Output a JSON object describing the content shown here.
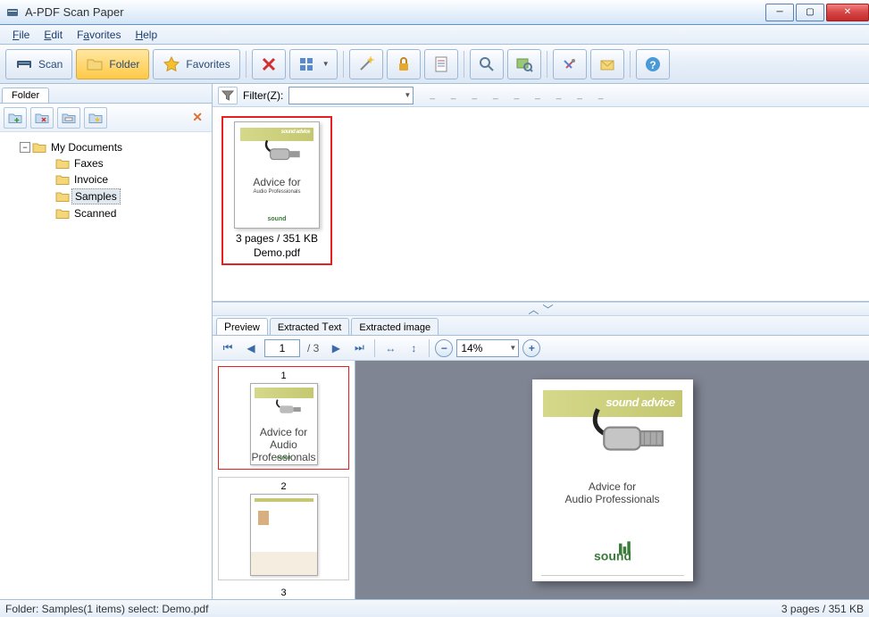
{
  "window": {
    "title": "A-PDF Scan Paper"
  },
  "menu": {
    "file": "File",
    "edit": "Edit",
    "favorites": "Favorites",
    "help": "Help"
  },
  "toolbar": {
    "scan": "Scan",
    "folder": "Folder",
    "favorites": "Favorites"
  },
  "folder_panel": {
    "tab": "Folder",
    "root": "My Documents",
    "children": [
      "Faxes",
      "Invoice",
      "Samples",
      "Scanned"
    ],
    "selected": "Samples"
  },
  "filter": {
    "label": "Filter(Z):"
  },
  "documents": [
    {
      "info": "3 pages / 351 KB",
      "filename": "Demo.pdf"
    }
  ],
  "doc_content": {
    "banner": "sound advice",
    "line1": "Advice for",
    "line2": "Audio Professionals",
    "logo": "sound"
  },
  "preview": {
    "tabs": [
      "Preview",
      "Extracted Text",
      "Extracted image"
    ],
    "active_tab": 0,
    "current_page": "1",
    "total_pages": "/ 3",
    "zoom": "14%",
    "thumbs": [
      "1",
      "2",
      "3"
    ]
  },
  "statusbar": {
    "left": "Folder: Samples(1 items) select: Demo.pdf",
    "right": "3 pages / 351 KB"
  }
}
